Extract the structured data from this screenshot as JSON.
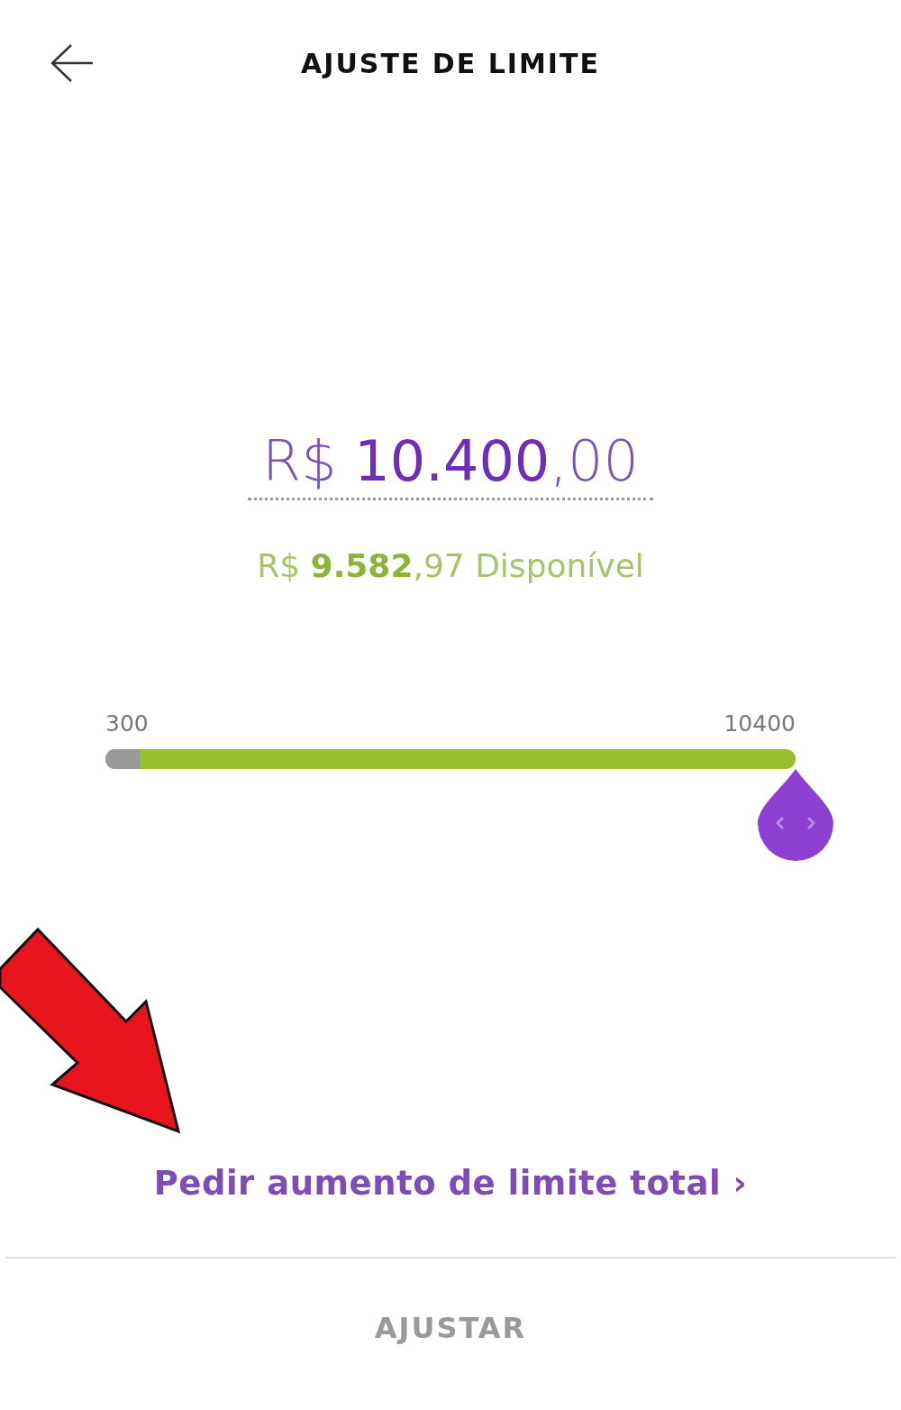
{
  "header": {
    "title": "AJUSTE DE LIMITE"
  },
  "limit": {
    "amount": "R$ **10.400**,00",
    "available": "R$ **9.582**,97 Disponível"
  },
  "slider": {
    "min_label": "300",
    "max_label": "10400",
    "level": 1,
    "used_segment": {
      "level": 0.05
    }
  },
  "link": "Pedir aumento de limite total ›",
  "button": "AJUSTAR"
}
